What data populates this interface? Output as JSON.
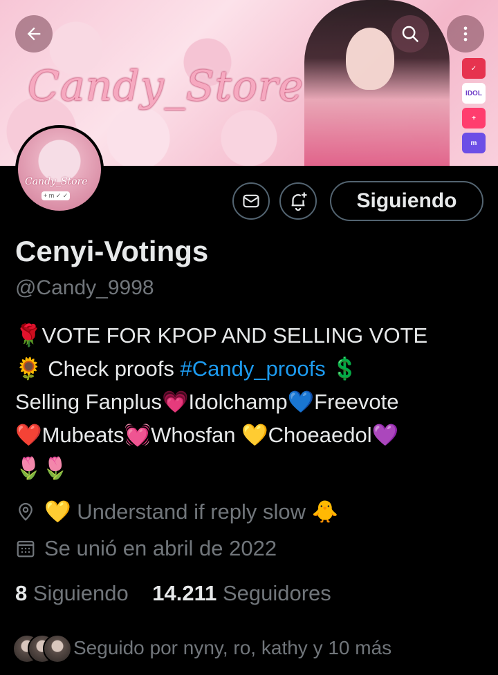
{
  "banner": {
    "title": "Candy_Store",
    "apps": [
      {
        "name": "fanplus",
        "label": "✓",
        "color": "#e6334f"
      },
      {
        "name": "idolchamp",
        "label": "IDOL",
        "color": "#ffffff"
      },
      {
        "name": "freevote",
        "label": "+",
        "color": "#ff3d6e"
      },
      {
        "name": "mubeat",
        "label": "m",
        "color": "#6c4ee6"
      }
    ]
  },
  "avatar": {
    "text": "Candy_Store",
    "icons": "+ m ✓ ✓"
  },
  "actions": {
    "follow_label": "Siguiendo"
  },
  "profile": {
    "name": "Cenyi-Votings",
    "handle": "@Candy_9998",
    "bio": {
      "line1": "🌹VOTE FOR KPOP AND SELLING VOTE",
      "line2_prefix": "🌻 Check proofs ",
      "hashtag": "#Candy_proofs",
      "line2_suffix": " 💲",
      "line3": "Selling Fanplus💗Idolchamp💙Freevote",
      "line4": "❤️Mubeats💓Whosfan 💛Choeaedol💜",
      "line5": "🌷🌷"
    },
    "location": "💛 Understand if reply slow 🐥",
    "joined": "Se unió en abril de 2022",
    "following_count": "8",
    "following_label": "Siguiendo",
    "followers_count": "14.211",
    "followers_label": "Seguidores",
    "followed_by": "Seguido por nyny, ro, kathy y 10 más"
  }
}
